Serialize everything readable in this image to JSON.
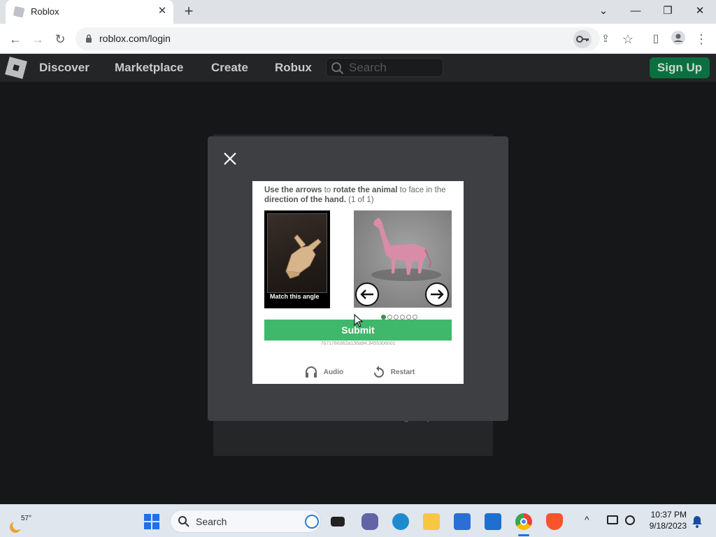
{
  "browser": {
    "tab_title": "Roblox",
    "url": "roblox.com/login"
  },
  "roblox_nav": {
    "items": [
      "Discover",
      "Marketplace",
      "Create",
      "Robux"
    ],
    "search_placeholder": "Search",
    "signup_label": "Sign Up"
  },
  "login_page": {
    "footer_text": "Don't have an account? Sign Up"
  },
  "captcha": {
    "instruction_parts": {
      "p1": "Use the arrows",
      "p2": " to ",
      "p3": "rotate the animal",
      "p4": " to face in the ",
      "p5": "direction of the hand.",
      "p6": " (1 of 1)"
    },
    "match_label": "Match this angle",
    "submit_label": "Submit",
    "session_id": "7671786362a136a94.3455306001",
    "audio_label": "Audio",
    "restart_label": "Restart",
    "page_dots": 6,
    "active_dot": 0
  },
  "taskbar": {
    "temperature": "57°",
    "search_label": "Search",
    "time": "10:37 PM",
    "date": "9/18/2023"
  },
  "colors": {
    "submit_green": "#3fb86b",
    "signup_green": "#0c6f40"
  }
}
